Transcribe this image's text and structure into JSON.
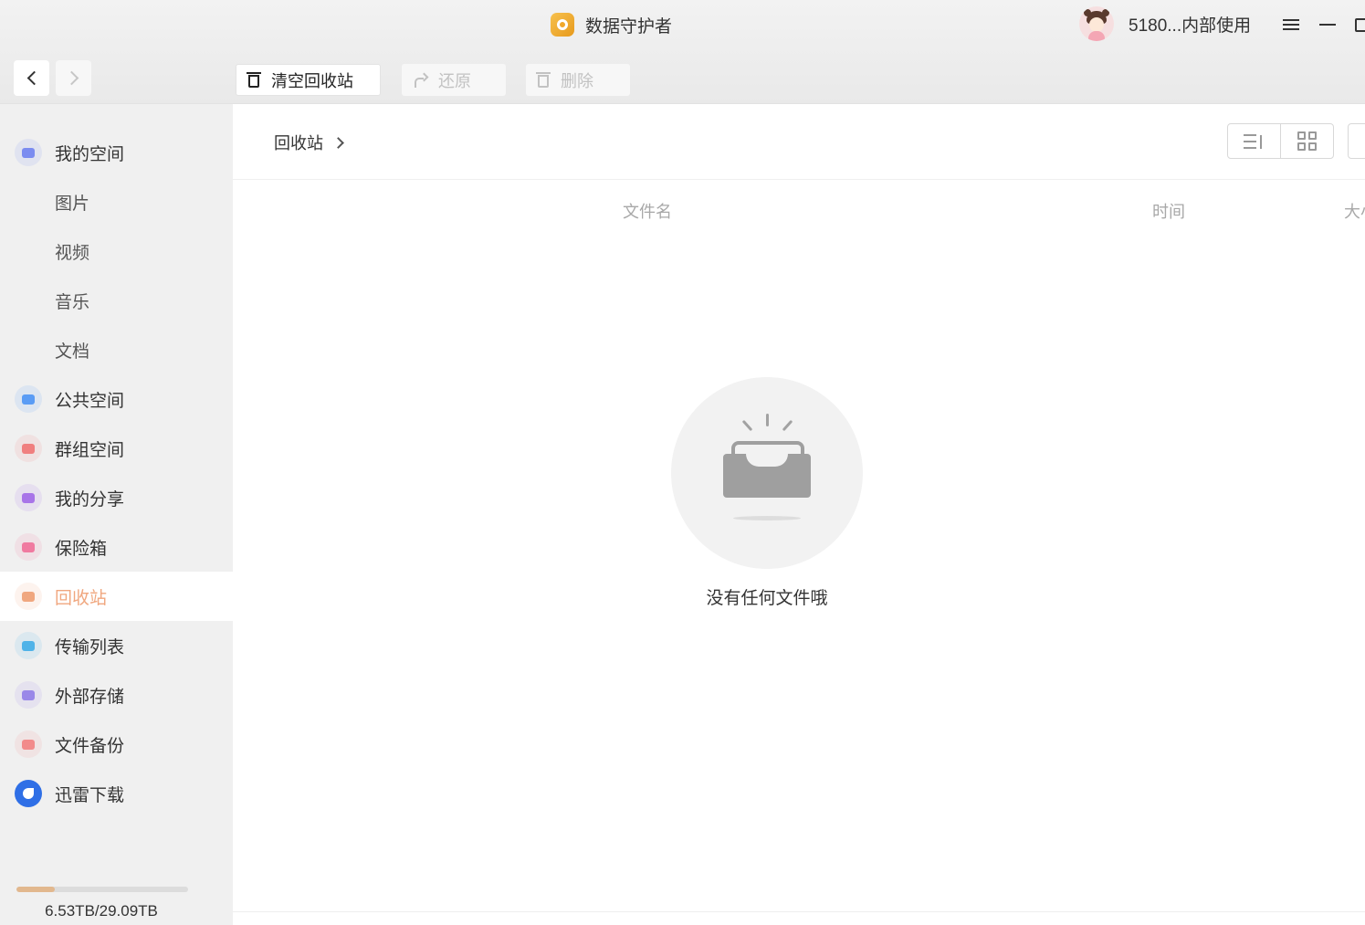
{
  "window": {
    "title": "数据守护者",
    "user_name": "5180...内部使用"
  },
  "toolbar": {
    "empty_recycle_label": "清空回收站",
    "restore_label": "还原",
    "delete_label": "删除"
  },
  "sidebar": {
    "items": [
      {
        "label": "我的空间",
        "icon": "folder-space-icon",
        "color": "#7b8cf0"
      },
      {
        "label": "图片"
      },
      {
        "label": "视频"
      },
      {
        "label": "音乐"
      },
      {
        "label": "文档"
      },
      {
        "label": "公共空间",
        "icon": "paper-plane-icon",
        "color": "#5a9cf5"
      },
      {
        "label": "群组空间",
        "icon": "group-icon",
        "color": "#f07f7f"
      },
      {
        "label": "我的分享",
        "icon": "share-image-icon",
        "color": "#a874e8"
      },
      {
        "label": "保险箱",
        "icon": "safe-box-icon",
        "color": "#f07aa0"
      },
      {
        "label": "回收站",
        "icon": "trash-icon",
        "color": "#f0a77f"
      },
      {
        "label": "传输列表",
        "icon": "transfer-icon",
        "color": "#4fb3e8"
      },
      {
        "label": "外部存储",
        "icon": "usb-drive-icon",
        "color": "#9a88e8"
      },
      {
        "label": "文件备份",
        "icon": "cloud-backup-icon",
        "color": "#f28b8b"
      },
      {
        "label": "迅雷下载",
        "icon": "thunder-bird-icon",
        "color": "#2f6fe6"
      }
    ],
    "active_index": 9,
    "storage": {
      "text": "6.53TB/29.09TB",
      "used_fraction": 0.2245
    }
  },
  "main": {
    "breadcrumb": "回收站",
    "columns": {
      "name": "文件名",
      "time": "时间",
      "size": "大小"
    },
    "empty_text": "没有任何文件哦"
  }
}
